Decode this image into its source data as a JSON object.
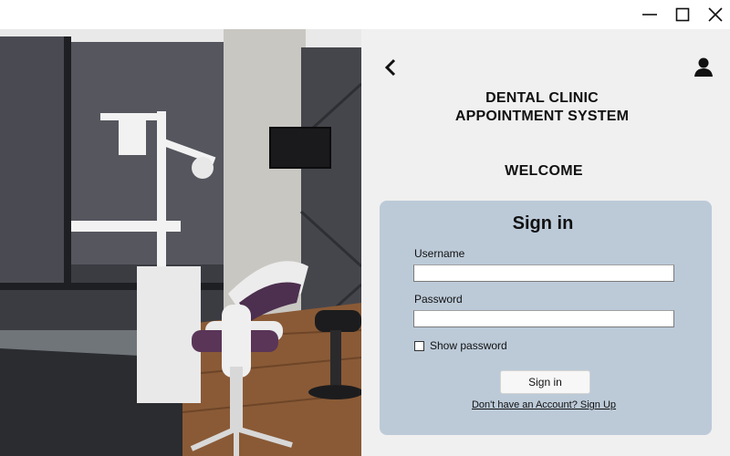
{
  "window": {
    "controls": [
      "minimize-icon",
      "maximize-icon",
      "close-icon"
    ]
  },
  "header": {
    "back_icon": "chevron-left-icon",
    "user_icon": "user-icon",
    "title_line1": "DENTAL CLINIC",
    "title_line2": "APPOINTMENT SYSTEM",
    "welcome": "WELCOME"
  },
  "signin": {
    "title": "Sign in",
    "username_label": "Username",
    "username_value": "",
    "password_label": "Password",
    "password_value": "",
    "show_password_label": "Show password",
    "show_password_checked": false,
    "button_label": "Sign in",
    "signup_link": "Don't have an Account? Sign Up"
  },
  "colors": {
    "panel_bg": "#f0f0f0",
    "card_bg": "#bccad8",
    "text": "#111111"
  }
}
